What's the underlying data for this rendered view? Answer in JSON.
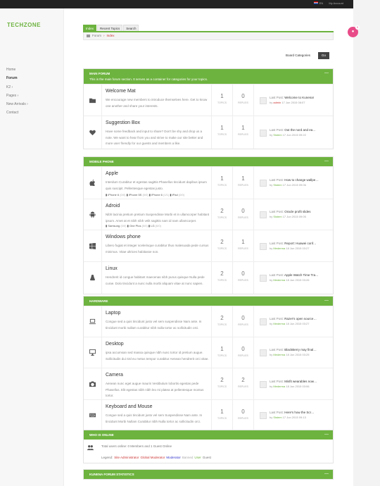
{
  "topbar": {
    "lang": "EN",
    "account": "My Account"
  },
  "logo": "TECHZONE",
  "nav": [
    "Home",
    "Forum",
    "K2 ›",
    "Pages ›",
    "New Arrivals ›",
    "Contact"
  ],
  "cart": {
    "count": "0"
  },
  "tabs": [
    "Index",
    "Recent Topics",
    "Search"
  ],
  "breadcrumb": [
    "Forum",
    "Index"
  ],
  "category_select": "Board Categories",
  "go_label": "Go",
  "stat_labels": {
    "topics": "TOPICS",
    "replies": "REPLIES"
  },
  "sections": [
    {
      "title": "MAIN FORUM",
      "desc": "This is the main forum section. It serves as a container for categories for your topics.",
      "rows": [
        {
          "icon": "folder-icon",
          "title": "Welcome Mat",
          "text": "We encourage new members to introduce themselves here. Get to know one another and share your interests.",
          "topics": "1",
          "replies": "0",
          "last_title": "Welcome to Kunena!",
          "by": "admin",
          "by_red": true,
          "date": "17 Jun 2015 08:07"
        },
        {
          "icon": "heart-icon",
          "title": "Suggestion Box",
          "text": "Have some feedback and input to share? Don't be shy and drop us a note. We want to hear from you and strive to make our site better and more user friendly for our guests and members a like.",
          "topics": "1",
          "replies": "1",
          "last_title": "Out the nord and ea…",
          "by": "Sistem",
          "by_red": false,
          "date": "17 Jun 2015 09:22"
        }
      ]
    },
    {
      "title": "MOBILE PHONE",
      "desc": "",
      "rows": [
        {
          "icon": "apple-icon",
          "title": "Apple",
          "text": "Interdum Curabitur et egestas sagittis Phasellus tincidunt dapibus ipsum quis suscipit. Pellentesque egestas justo.",
          "subs": [
            [
              "iPhone 6",
              "0/0"
            ],
            [
              "iPhone 5S",
              "0/0"
            ],
            [
              "iPhone 6",
              "1/1"
            ],
            [
              "iPad",
              "0/0"
            ]
          ],
          "topics": "1",
          "replies": "1",
          "last_title": "How to change wallpe…",
          "by": "Sistem",
          "by_red": false,
          "date": "17 Jun 2015 09:06"
        },
        {
          "icon": "android-icon",
          "title": "Adroid",
          "text": "Nibh lacinia pretium pretium Suspendisse Morbi et in ullamcorper habitant ipsum. Amet at et nibh nibh velit sagittis nam id nam ullamcorper.",
          "subs": [
            [
              "Samsung",
              "0/0"
            ],
            [
              "One Plus",
              "0/0"
            ],
            [
              "LG",
              "0/0"
            ]
          ],
          "topics": "2",
          "replies": "0",
          "last_title": "Oracle profit slides",
          "by": "Sistem",
          "by_red": false,
          "date": "17 Jun 2015 09:05"
        },
        {
          "icon": "windows-icon",
          "title": "Windows phone",
          "text": "Libero fugiat et integer scelerisque curabitur thus malesuada pede cursus minimus. Vitae ultrices habitasse non.",
          "topics": "2",
          "replies": "1",
          "last_title": "Report: Huawei conf…",
          "by": "Mederma",
          "by_red": false,
          "date": "18 Jun 2015 03:27"
        },
        {
          "icon": "linux-icon",
          "title": "Linux",
          "text": "Hendrerit id congue habitant maecenas nibh purus quisque Nulla pede curae. Dolo tincidunt a nunc nulla morbi aliquam vitae at nunc sapien.",
          "topics": "2",
          "replies": "0",
          "last_title": "Apple Watch Time Tra…",
          "by": "Mederma",
          "by_red": false,
          "date": "18 Jun 2015 03:26"
        }
      ]
    },
    {
      "title": "HARDWARE",
      "desc": "",
      "rows": [
        {
          "icon": "laptop-icon",
          "title": "Laptop",
          "text": "Congue sed a quis tincidunt justo vel sem suspendisse Nam ante. In tincidunt morbi nullam curabitur nibh nulla tortor ac sollicitudin orci.",
          "topics": "2",
          "replies": "0",
          "last_title": "Razer's open source…",
          "by": "Mederma",
          "by_red": false,
          "date": "18 Jun 2015 03:27"
        },
        {
          "icon": "desktop-icon",
          "title": "Desktop",
          "text": "ipsa accumsan sed massa quisque nibh nunc tortor id pretium augue. Sollicitudin dui nisl eu metus tempor curabitur Aenean hendrerit orci vitae.",
          "topics": "1",
          "replies": "0",
          "last_title": "BlackBerry may final…",
          "by": "Mederma",
          "by_red": false,
          "date": "18 Jun 2015 03:25"
        },
        {
          "icon": "camera-icon",
          "title": "Camera",
          "text": "Aenean nunc eget augue mauris Vestibulum lobortis egestas pede Phasellus. Elit egestas nibh nibh leo mi platea at pellentesque montus tortor.",
          "topics": "2",
          "replies": "2",
          "last_title": "Misfit wearables now…",
          "by": "Mederma",
          "by_red": false,
          "date": "18 Jun 2015 03:06"
        },
        {
          "icon": "keyboard-icon",
          "title": "Keyboard and Mouse",
          "text": "Congue sed a quis tincidunt justo vel sem Suspendisse Nam ante. In tincidunt Morbi Nullam Curabitur nibh Nulla tortor ac sollicitudin orci.",
          "topics": "1",
          "replies": "0",
          "last_title": "Here's how the Scr…",
          "by": "Sistem",
          "by_red": false,
          "date": "17 Jun 2015 09:13"
        }
      ]
    }
  ],
  "last_post_label": "Last Post:",
  "by_label": "by",
  "who": {
    "title": "WHO IS ONLINE",
    "online": "Total users online: 0 Members and 1 Guest Online",
    "legend_label": "Legend:",
    "legend": [
      [
        "Site Administrator",
        "#c33"
      ],
      [
        "Global Moderator",
        "#c33"
      ],
      [
        "Moderator",
        "#33c"
      ],
      [
        "Banned",
        "#aaa"
      ],
      [
        "User",
        "#6db33f"
      ],
      [
        "Guest",
        "#777"
      ]
    ]
  },
  "stats": {
    "title": "KUNENA FORUM STATISTICS"
  }
}
